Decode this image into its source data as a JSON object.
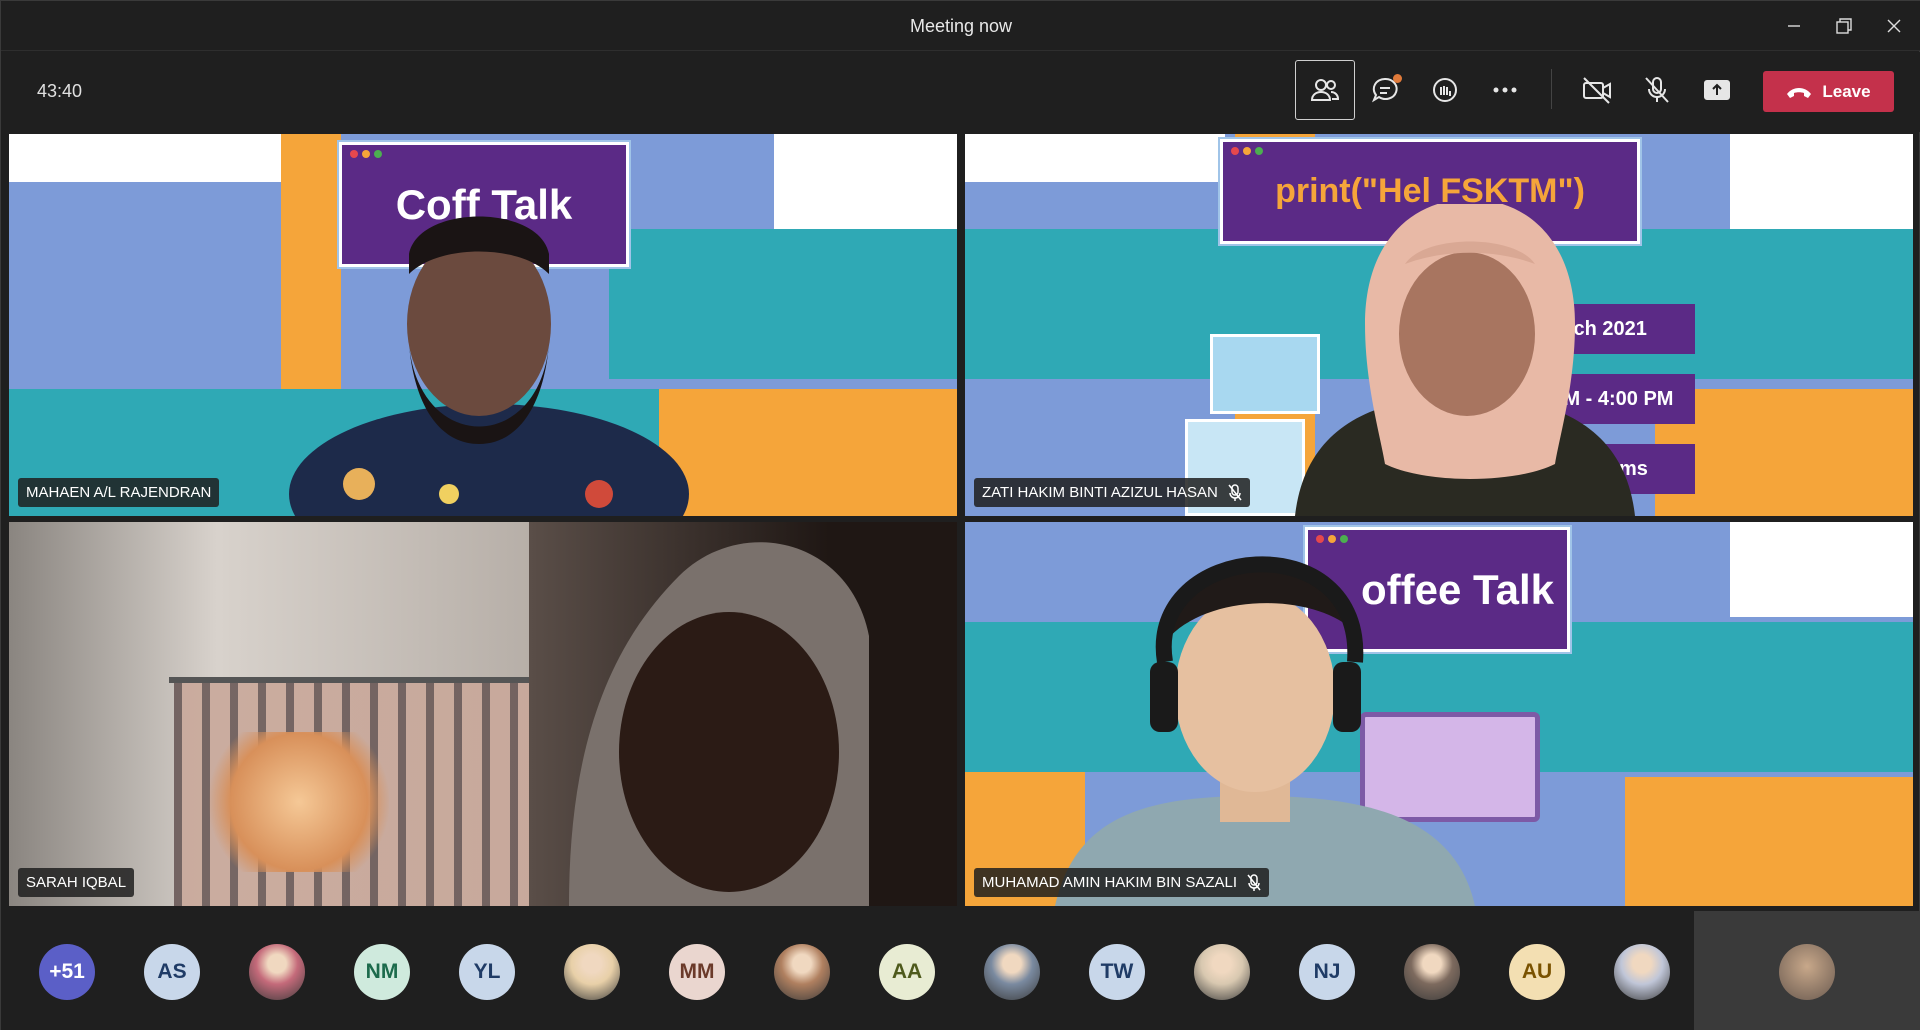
{
  "window": {
    "title": "Meeting now"
  },
  "toolbar": {
    "timer": "43:40",
    "leave_label": "Leave"
  },
  "tiles": [
    {
      "name": "MAHAEN A/L RAJENDRAN",
      "muted": false,
      "slide_text": "Coff   Talk"
    },
    {
      "name": "ZATI HAKIM BINTI AZIZUL HASAN",
      "muted": true,
      "slide_text": "print(\"Hel   FSKTM\")",
      "slide_lines": [
        "larch 2021",
        "AM - 4:00 PM",
        "ms"
      ]
    },
    {
      "name": "SARAH IQBAL",
      "muted": false
    },
    {
      "name": "MUHAMAD AMIN HAKIM BIN SAZALI",
      "muted": true,
      "slide_text": "offee Talk"
    }
  ],
  "roster": [
    {
      "label": "+51",
      "bg": "#5b5fc7",
      "fg": "#ffffff"
    },
    {
      "label": "AS",
      "bg": "#c8d7ea",
      "fg": "#1f3b66"
    },
    {
      "label": "",
      "bg": "#c46a7a",
      "fg": "#ffffff",
      "icon": "photo-avatar"
    },
    {
      "label": "NM",
      "bg": "#cfeadd",
      "fg": "#1c6b4c"
    },
    {
      "label": "YL",
      "bg": "#c8d7ea",
      "fg": "#1f3b66"
    },
    {
      "label": "",
      "bg": "#e8d0a8",
      "fg": "#ffffff",
      "icon": "photo-avatar"
    },
    {
      "label": "MM",
      "bg": "#ead6cf",
      "fg": "#6b3a2a"
    },
    {
      "label": "",
      "bg": "#b08060",
      "fg": "#ffffff",
      "icon": "photo-avatar"
    },
    {
      "label": "AA",
      "bg": "#e8ecd3",
      "fg": "#4e5a1c"
    },
    {
      "label": "",
      "bg": "#7a8aa0",
      "fg": "#ffffff",
      "icon": "photo-avatar"
    },
    {
      "label": "TW",
      "bg": "#c8d7ea",
      "fg": "#1f3b66"
    },
    {
      "label": "",
      "bg": "#d8c8b0",
      "fg": "#ffffff",
      "icon": "photo-avatar"
    },
    {
      "label": "NJ",
      "bg": "#c8d7ea",
      "fg": "#1f3b66"
    },
    {
      "label": "",
      "bg": "#7d6a5e",
      "fg": "#ffffff",
      "icon": "photo-avatar"
    },
    {
      "label": "AU",
      "bg": "#f3dfb2",
      "fg": "#7a5200"
    },
    {
      "label": "",
      "bg": "#c0c6d8",
      "fg": "#ffffff",
      "icon": "photo-avatar"
    }
  ],
  "colors": {
    "leave": "#c4314b",
    "teal": "#2fa9b5",
    "orange": "#f5a53a",
    "purple": "#5b2a86",
    "blue": "#7d9bd8"
  }
}
